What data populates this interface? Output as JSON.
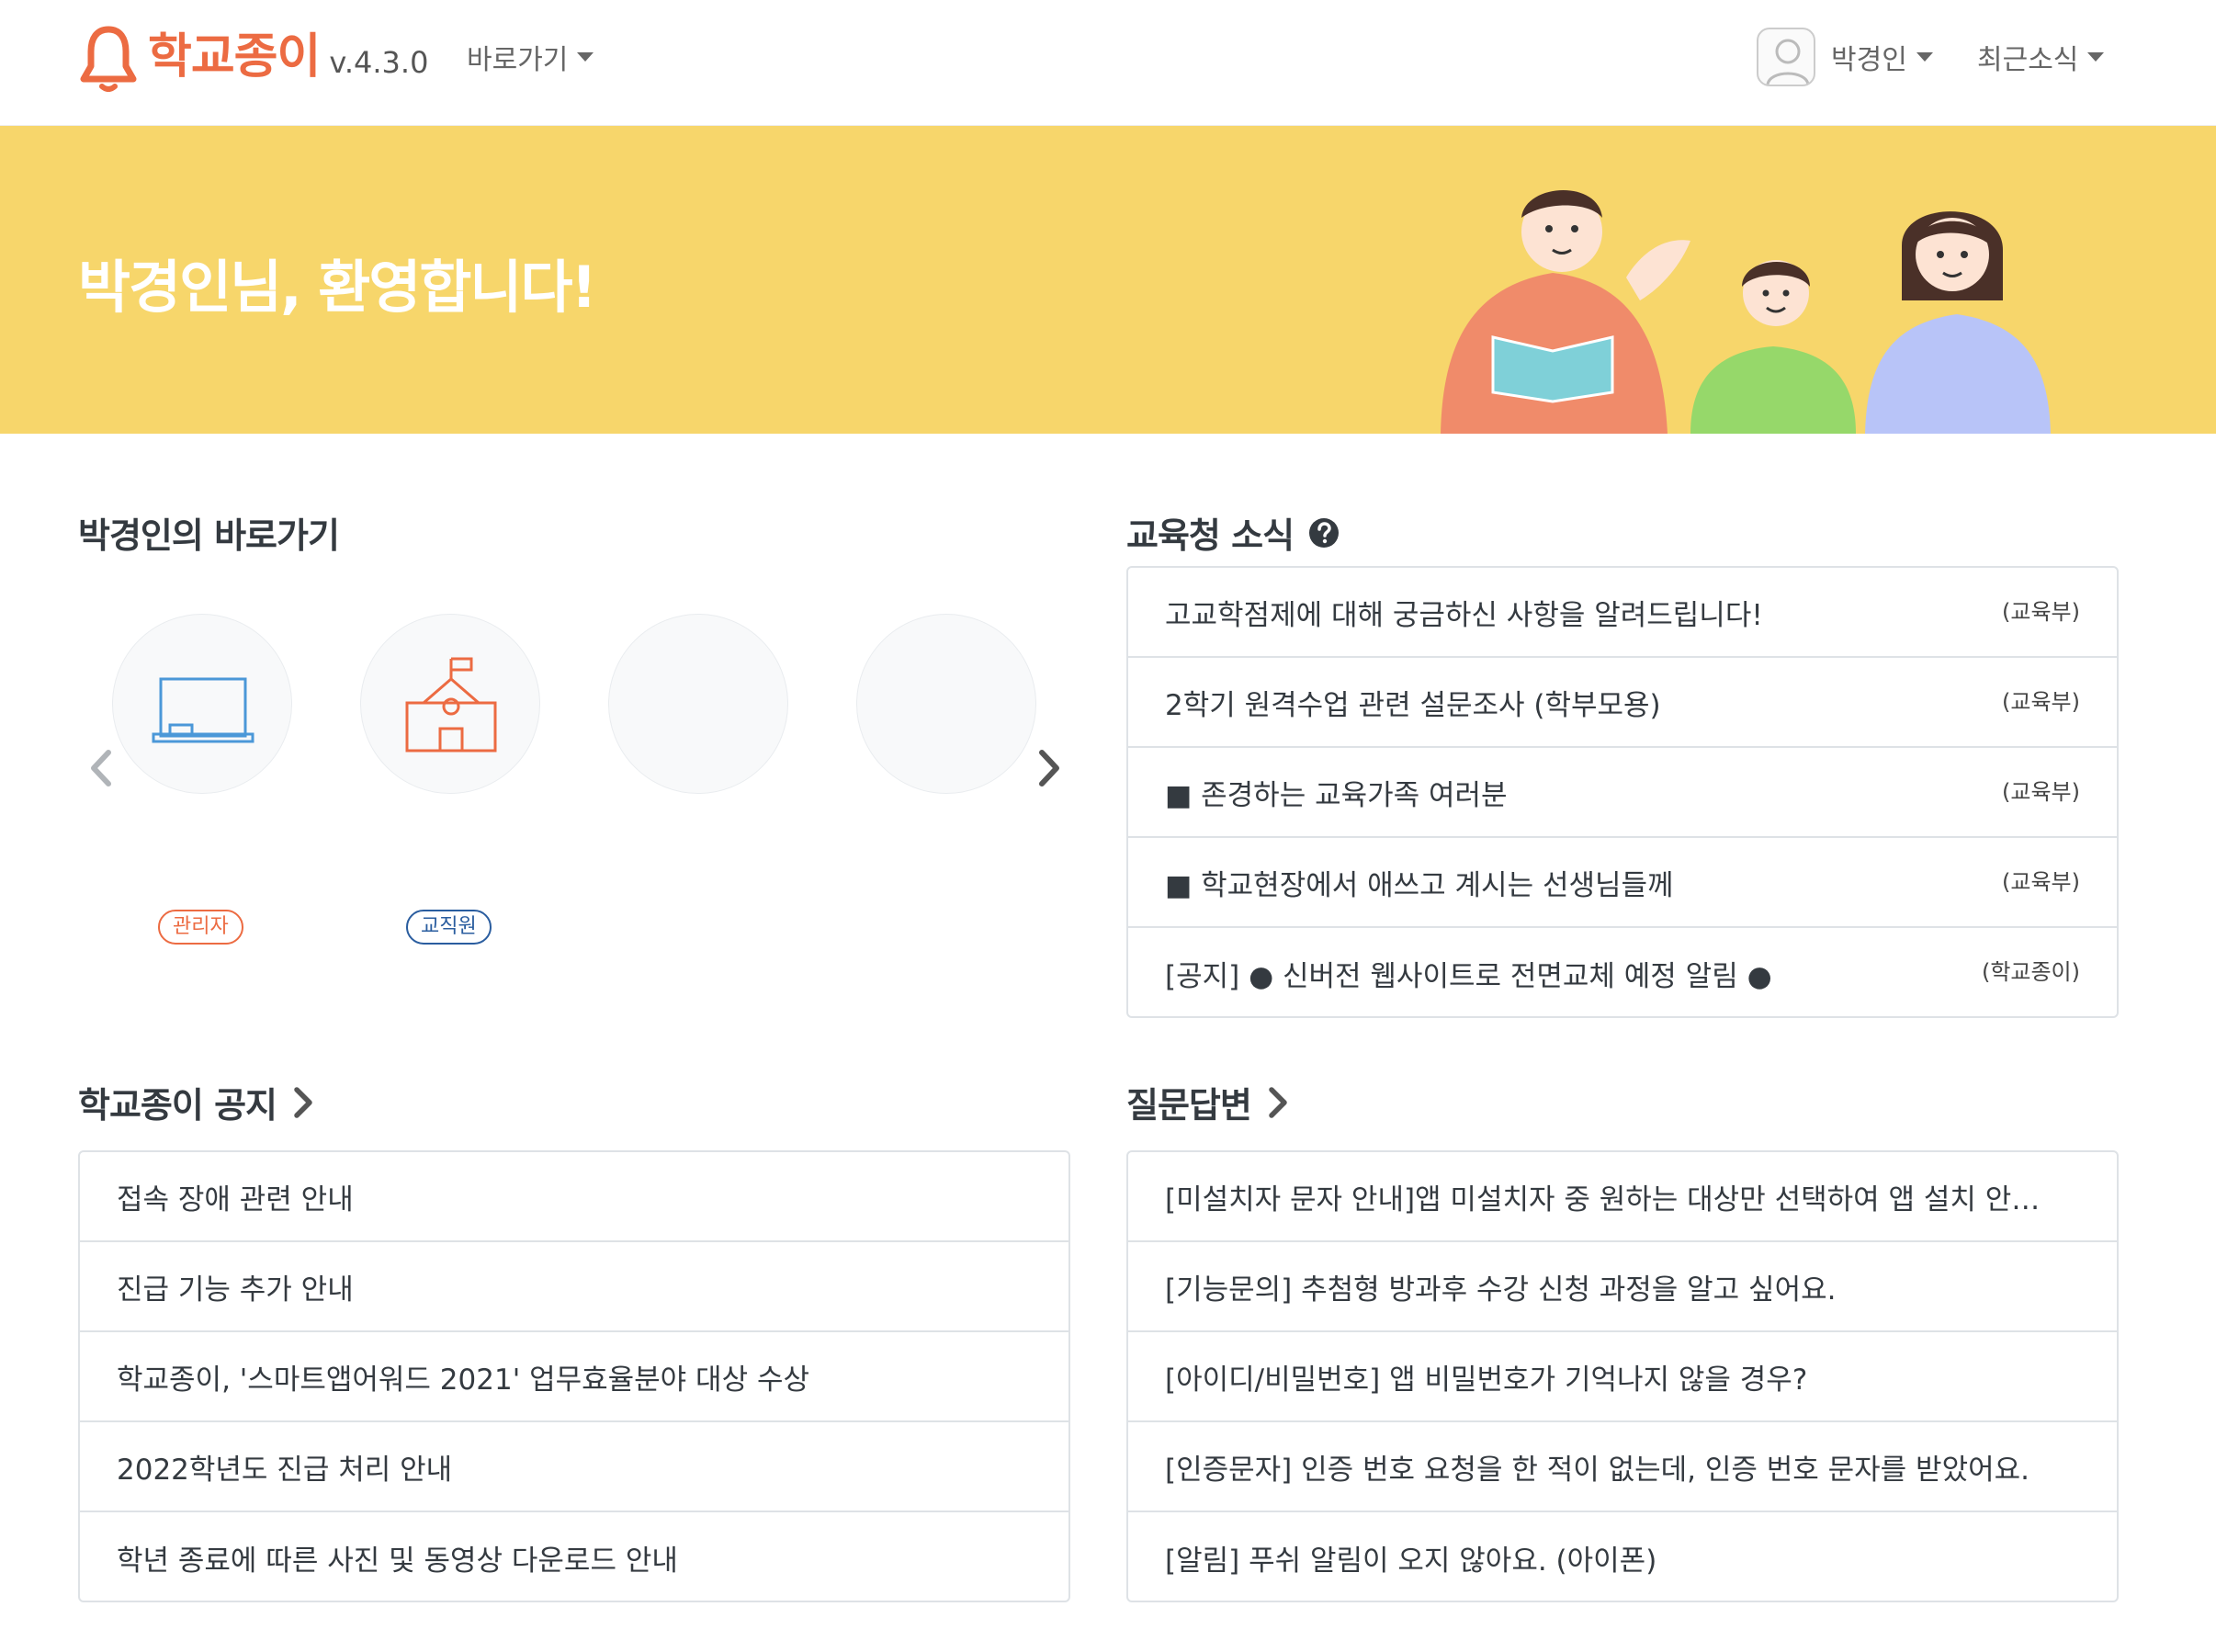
{
  "navbar": {
    "logo_text": "학교종이",
    "version": "v.4.3.0",
    "shortcut_menu": "바로가기",
    "user_name": "박경인",
    "news_menu": "최근소식"
  },
  "hero": {
    "welcome": "박경인님, 환영합니다!"
  },
  "shortcuts": {
    "title": "박경인의 바로가기",
    "items": [
      {
        "badge": "관리자",
        "icon": "blackboard-icon",
        "color": "#ec6b42"
      },
      {
        "badge": "교직원",
        "icon": "school-icon",
        "color": "#2a5d9f"
      }
    ]
  },
  "edu_news": {
    "title": "교육청 소식",
    "items": [
      {
        "text": "고교학점제에 대해 궁금하신 사항을 알려드립니다!",
        "source": "(교육부)"
      },
      {
        "text": "2학기 원격수업 관련 설문조사 (학부모용)",
        "source": "(교육부)"
      },
      {
        "text": "■ 존경하는 교육가족 여러분",
        "source": "(교육부)"
      },
      {
        "text": "■ 학교현장에서 애쓰고 계시는 선생님들께",
        "source": "(교육부)"
      },
      {
        "text": "[공지] ● 신버전 웹사이트로 전면교체 예정 알림 ●",
        "source": "(학교종이)"
      }
    ]
  },
  "notices": {
    "title": "학교종이 공지",
    "items": [
      "접속 장애 관련 안내",
      "진급 기능 추가 안내",
      "학교종이, '스마트앱어워드 2021' 업무효율분야 대상 수상",
      "2022학년도 진급 처리 안내",
      "학년 종료에 따른 사진 및 동영상 다운로드 안내"
    ]
  },
  "qna": {
    "title": "질문답변",
    "items": [
      "[미설치자 문자 안내]앱 미설치자 중 원하는 대상만 선택하여 앱 설치 안내 문...",
      "[기능문의] 추첨형 방과후 수강 신청 과정을 알고 싶어요.",
      "[아이디/비밀번호] 앱 비밀번호가 기억나지 않을 경우?",
      "[인증문자] 인증 번호 요청을 한 적이 없는데, 인증 번호 문자를 받았어요.",
      "[알림] 푸쉬 알림이 오지 않아요. (아이폰)"
    ]
  }
}
